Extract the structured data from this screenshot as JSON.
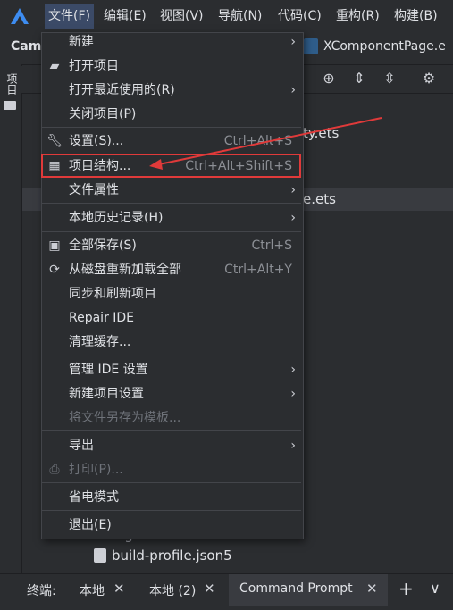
{
  "menubar": {
    "items": [
      {
        "label": "文件(F)"
      },
      {
        "label": "编辑(E)"
      },
      {
        "label": "视图(V)"
      },
      {
        "label": "导航(N)"
      },
      {
        "label": "代码(C)"
      },
      {
        "label": "重构(R)"
      },
      {
        "label": "构建(B)"
      }
    ]
  },
  "toolbar": {
    "project_label": "Cam",
    "open_file_tab": "XComponentPage.e"
  },
  "side_panel": {
    "tab_label": "项目"
  },
  "tree": {
    "items": [
      {
        "label": "ty.ets"
      },
      {
        "label": "e.ets"
      },
      {
        "label": "...gnore"
      },
      {
        "label": "build-profile.json5"
      }
    ]
  },
  "dropdown": {
    "items": [
      {
        "label": "新建",
        "shortcut": "",
        "submenu": true,
        "icon": ""
      },
      {
        "label": "打开项目",
        "shortcut": "",
        "submenu": false,
        "icon": "folder-open-icon"
      },
      {
        "label": "打开最近使用的(R)",
        "shortcut": "",
        "submenu": true,
        "icon": ""
      },
      {
        "label": "关闭项目(P)",
        "shortcut": "",
        "submenu": false,
        "icon": ""
      },
      {
        "label": "设置(S)...",
        "shortcut": "Ctrl+Alt+S",
        "submenu": false,
        "icon": "wrench-icon"
      },
      {
        "label": "项目结构...",
        "shortcut": "Ctrl+Alt+Shift+S",
        "submenu": false,
        "icon": "project-structure-icon"
      },
      {
        "label": "文件属性",
        "shortcut": "",
        "submenu": true,
        "icon": ""
      },
      {
        "label": "本地历史记录(H)",
        "shortcut": "",
        "submenu": true,
        "icon": ""
      },
      {
        "label": "全部保存(S)",
        "shortcut": "Ctrl+S",
        "submenu": false,
        "icon": "save-icon"
      },
      {
        "label": "从磁盘重新加载全部",
        "shortcut": "Ctrl+Alt+Y",
        "submenu": false,
        "icon": "reload-icon"
      },
      {
        "label": "同步和刷新项目",
        "shortcut": "",
        "submenu": false,
        "icon": ""
      },
      {
        "label": "Repair IDE",
        "shortcut": "",
        "submenu": false,
        "icon": ""
      },
      {
        "label": "清理缓存...",
        "shortcut": "",
        "submenu": false,
        "icon": ""
      },
      {
        "label": "管理 IDE 设置",
        "shortcut": "",
        "submenu": true,
        "icon": ""
      },
      {
        "label": "新建项目设置",
        "shortcut": "",
        "submenu": true,
        "icon": ""
      },
      {
        "label": "将文件另存为模板...",
        "shortcut": "",
        "submenu": false,
        "icon": "",
        "disabled": true
      },
      {
        "label": "导出",
        "shortcut": "",
        "submenu": true,
        "icon": ""
      },
      {
        "label": "打印(P)...",
        "shortcut": "",
        "submenu": false,
        "icon": "printer-icon",
        "disabled": true
      },
      {
        "label": "省电模式",
        "shortcut": "",
        "submenu": false,
        "icon": ""
      },
      {
        "label": "退出(E)",
        "shortcut": "",
        "submenu": false,
        "icon": ""
      }
    ]
  },
  "terminal": {
    "label": "终端:",
    "tabs": [
      {
        "label": "本地"
      },
      {
        "label": "本地 (2)"
      },
      {
        "label": "Command Prompt"
      }
    ],
    "add_label": "+",
    "chevron_label": "∨"
  },
  "colors": {
    "background": "#2b2d30",
    "highlight_box": "#e03a3a",
    "active_menu": "#3b4a67"
  }
}
